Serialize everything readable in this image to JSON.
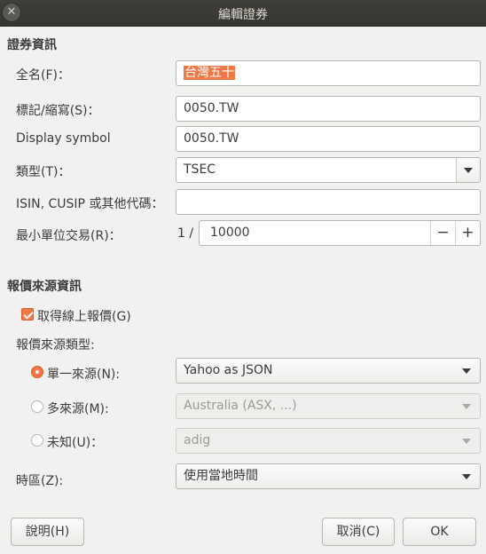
{
  "window": {
    "title": "編輯證券"
  },
  "security_info": {
    "heading": "證券資訊",
    "full_name_label": "全名(F)：",
    "full_name_value": "台灣五十",
    "ticker_label": "標記/縮寫(S)：",
    "ticker_value": "0050.TW",
    "display_symbol_label": "Display symbol",
    "display_symbol_value": "0050.TW",
    "type_label": "類型(T)：",
    "type_value": "TSEC",
    "isin_label": "ISIN, CUSIP 或其他代碼：",
    "isin_value": "",
    "min_unit_label": "最小單位交易(R)：",
    "min_unit_prefix": "1 /",
    "min_unit_value": "10000",
    "minus": "−",
    "plus": "+"
  },
  "quote_source": {
    "heading": "報價來源資訊",
    "get_online_label": "取得線上報價(G)",
    "get_online_checked": true,
    "source_type_label": "報價來源類型:",
    "single_label": "單一來源(N):",
    "single_value": "Yahoo as JSON",
    "multiple_label": "多來源(M):",
    "multiple_value": "Australia (ASX, ...)",
    "unknown_label": "未知(U)：",
    "unknown_value": "adig",
    "timezone_label": "時區(Z):",
    "timezone_value": "使用當地時間"
  },
  "buttons": {
    "help": "說明(H)",
    "cancel": "取消(C)",
    "ok": "OK"
  },
  "colors": {
    "accent": "#f07746",
    "titlebar": "#3c3b37"
  }
}
